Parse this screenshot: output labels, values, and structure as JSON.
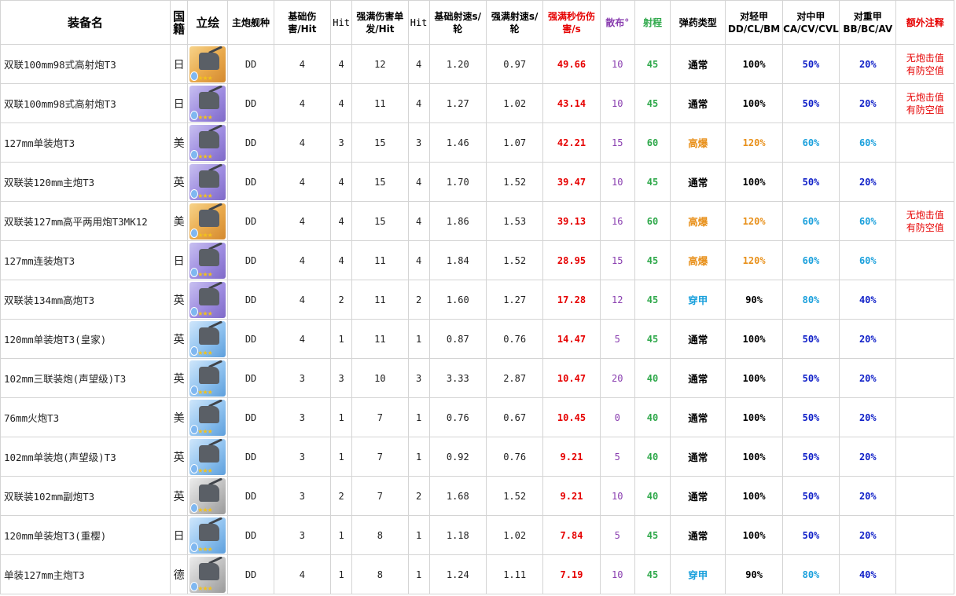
{
  "headers": [
    "装备名",
    "国籍",
    "立绘",
    "主炮舰种",
    "基础伤害/Hit",
    "Hit",
    "强满伤害单发/Hit",
    "Hit",
    "基础射速s/轮",
    "强满射速s/轮",
    "强满秒伤伤害/s",
    "散布°",
    "射程",
    "弹药类型",
    "对轻甲DD/CL/BM",
    "对中甲CA/CV/CVL",
    "对重甲BB/BC/AV",
    "额外注释"
  ],
  "colors": {
    "dps": "#e60000",
    "spread": "#8a3fb0",
    "range": "#2ea84a",
    "he": "#e8901a",
    "ap": "#1aa0dc",
    "medium": "#1020c8",
    "note": "#e60000"
  },
  "rows": [
    {
      "name": "双联100mm98式高射炮T3",
      "nation": "日",
      "icon": "gold",
      "ship": "DD",
      "base_dmg": "4",
      "hit1": "4",
      "max_dmg": "12",
      "hit2": "4",
      "base_rate": "1.20",
      "max_rate": "0.97",
      "dps": "49.66",
      "spread": "10",
      "range": "45",
      "ammo": "通常",
      "light": "100%",
      "medium": "50%",
      "heavy": "20%",
      "note1": "无炮击值",
      "note2": "有防空值"
    },
    {
      "name": "双联100mm98式高射炮T3",
      "nation": "日",
      "icon": "purple",
      "ship": "DD",
      "base_dmg": "4",
      "hit1": "4",
      "max_dmg": "11",
      "hit2": "4",
      "base_rate": "1.27",
      "max_rate": "1.02",
      "dps": "43.14",
      "spread": "10",
      "range": "45",
      "ammo": "通常",
      "light": "100%",
      "medium": "50%",
      "heavy": "20%",
      "note1": "无炮击值",
      "note2": "有防空值"
    },
    {
      "name": "127mm单装炮T3",
      "nation": "美",
      "icon": "purple",
      "ship": "DD",
      "base_dmg": "4",
      "hit1": "3",
      "max_dmg": "15",
      "hit2": "3",
      "base_rate": "1.46",
      "max_rate": "1.07",
      "dps": "42.21",
      "spread": "15",
      "range": "60",
      "ammo": "高爆",
      "light": "120%",
      "medium": "60%",
      "heavy": "60%",
      "note1": "",
      "note2": ""
    },
    {
      "name": "双联装120mm主炮T3",
      "nation": "英",
      "icon": "purple",
      "ship": "DD",
      "base_dmg": "4",
      "hit1": "4",
      "max_dmg": "15",
      "hit2": "4",
      "base_rate": "1.70",
      "max_rate": "1.52",
      "dps": "39.47",
      "spread": "10",
      "range": "45",
      "ammo": "通常",
      "light": "100%",
      "medium": "50%",
      "heavy": "20%",
      "note1": "",
      "note2": ""
    },
    {
      "name": "双联装127mm高平两用炮T3MK12",
      "nation": "美",
      "icon": "gold",
      "ship": "DD",
      "base_dmg": "4",
      "hit1": "4",
      "max_dmg": "15",
      "hit2": "4",
      "base_rate": "1.86",
      "max_rate": "1.53",
      "dps": "39.13",
      "spread": "16",
      "range": "60",
      "ammo": "高爆",
      "light": "120%",
      "medium": "60%",
      "heavy": "60%",
      "note1": "无炮击值",
      "note2": "有防空值"
    },
    {
      "name": "127mm连装炮T3",
      "nation": "日",
      "icon": "purple",
      "ship": "DD",
      "base_dmg": "4",
      "hit1": "4",
      "max_dmg": "11",
      "hit2": "4",
      "base_rate": "1.84",
      "max_rate": "1.52",
      "dps": "28.95",
      "spread": "15",
      "range": "45",
      "ammo": "高爆",
      "light": "120%",
      "medium": "60%",
      "heavy": "60%",
      "note1": "",
      "note2": ""
    },
    {
      "name": "双联装134mm高炮T3",
      "nation": "英",
      "icon": "purple",
      "ship": "DD",
      "base_dmg": "4",
      "hit1": "2",
      "max_dmg": "11",
      "hit2": "2",
      "base_rate": "1.60",
      "max_rate": "1.27",
      "dps": "17.28",
      "spread": "12",
      "range": "45",
      "ammo": "穿甲",
      "light": "90%",
      "medium": "80%",
      "heavy": "40%",
      "note1": "",
      "note2": ""
    },
    {
      "name": "120mm单装炮T3(皇家)",
      "nation": "英",
      "icon": "blue",
      "ship": "DD",
      "base_dmg": "4",
      "hit1": "1",
      "max_dmg": "11",
      "hit2": "1",
      "base_rate": "0.87",
      "max_rate": "0.76",
      "dps": "14.47",
      "spread": "5",
      "range": "45",
      "ammo": "通常",
      "light": "100%",
      "medium": "50%",
      "heavy": "20%",
      "note1": "",
      "note2": ""
    },
    {
      "name": "102mm三联装炮(声望级)T3",
      "nation": "英",
      "icon": "blue",
      "ship": "DD",
      "base_dmg": "3",
      "hit1": "3",
      "max_dmg": "10",
      "hit2": "3",
      "base_rate": "3.33",
      "max_rate": "2.87",
      "dps": "10.47",
      "spread": "20",
      "range": "40",
      "ammo": "通常",
      "light": "100%",
      "medium": "50%",
      "heavy": "20%",
      "note1": "",
      "note2": ""
    },
    {
      "name": "76mm火炮T3",
      "nation": "美",
      "icon": "blue",
      "ship": "DD",
      "base_dmg": "3",
      "hit1": "1",
      "max_dmg": "7",
      "hit2": "1",
      "base_rate": "0.76",
      "max_rate": "0.67",
      "dps": "10.45",
      "spread": "0",
      "range": "40",
      "ammo": "通常",
      "light": "100%",
      "medium": "50%",
      "heavy": "20%",
      "note1": "",
      "note2": ""
    },
    {
      "name": "102mm单装炮(声望级)T3",
      "nation": "英",
      "icon": "blue",
      "ship": "DD",
      "base_dmg": "3",
      "hit1": "1",
      "max_dmg": "7",
      "hit2": "1",
      "base_rate": "0.92",
      "max_rate": "0.76",
      "dps": "9.21",
      "spread": "5",
      "range": "40",
      "ammo": "通常",
      "light": "100%",
      "medium": "50%",
      "heavy": "20%",
      "note1": "",
      "note2": ""
    },
    {
      "name": "双联装102mm副炮T3",
      "nation": "英",
      "icon": "silver",
      "ship": "DD",
      "base_dmg": "3",
      "hit1": "2",
      "max_dmg": "7",
      "hit2": "2",
      "base_rate": "1.68",
      "max_rate": "1.52",
      "dps": "9.21",
      "spread": "10",
      "range": "40",
      "ammo": "通常",
      "light": "100%",
      "medium": "50%",
      "heavy": "20%",
      "note1": "",
      "note2": ""
    },
    {
      "name": "120mm单装炮T3(重樱)",
      "nation": "日",
      "icon": "blue",
      "ship": "DD",
      "base_dmg": "3",
      "hit1": "1",
      "max_dmg": "8",
      "hit2": "1",
      "base_rate": "1.18",
      "max_rate": "1.02",
      "dps": "7.84",
      "spread": "5",
      "range": "45",
      "ammo": "通常",
      "light": "100%",
      "medium": "50%",
      "heavy": "20%",
      "note1": "",
      "note2": ""
    },
    {
      "name": "单装127mm主炮T3",
      "nation": "德",
      "icon": "silver",
      "ship": "DD",
      "base_dmg": "4",
      "hit1": "1",
      "max_dmg": "8",
      "hit2": "1",
      "base_rate": "1.24",
      "max_rate": "1.11",
      "dps": "7.19",
      "spread": "10",
      "range": "45",
      "ammo": "穿甲",
      "light": "90%",
      "medium": "80%",
      "heavy": "40%",
      "note1": "",
      "note2": ""
    }
  ]
}
